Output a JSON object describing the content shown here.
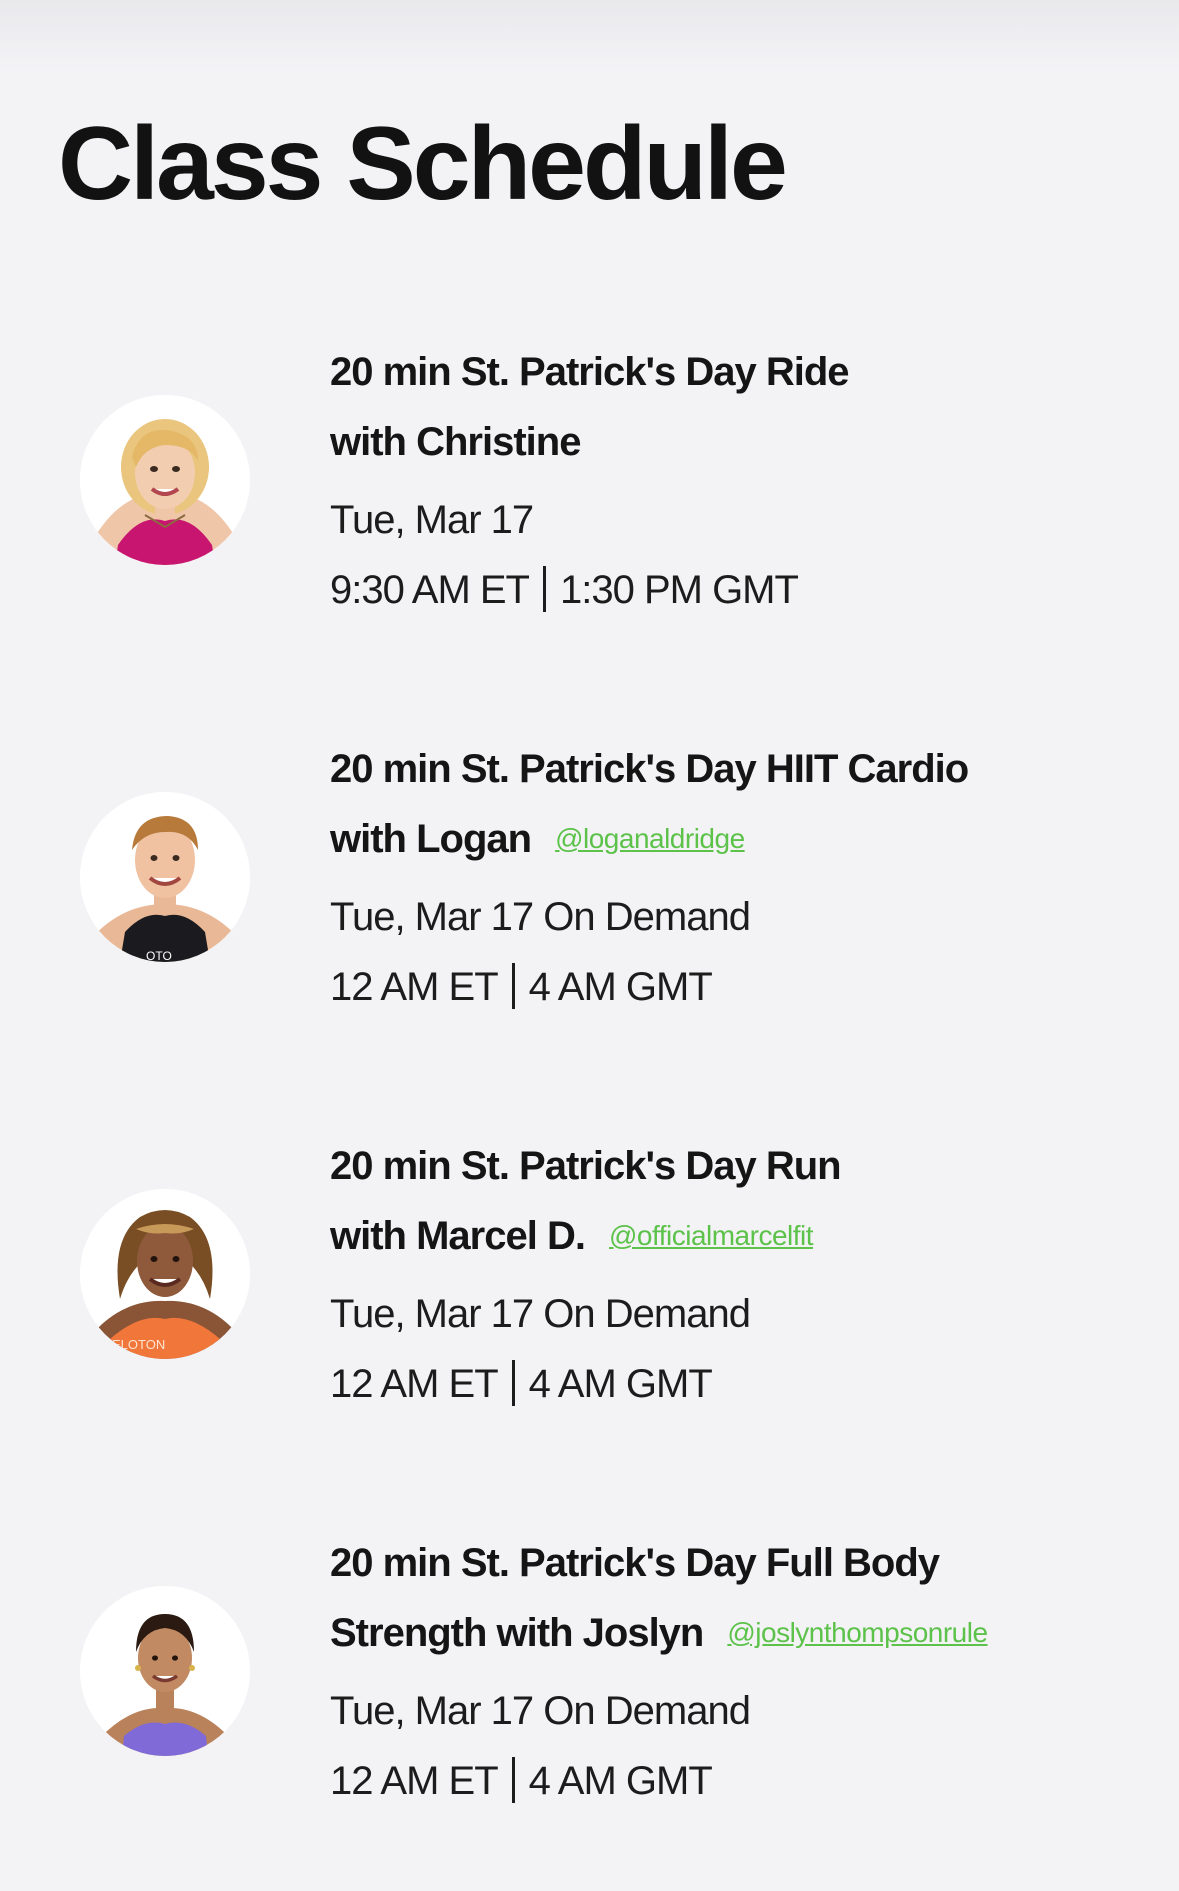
{
  "page": {
    "title": "Class Schedule"
  },
  "classes": [
    {
      "title_line1": "20 min St. Patrick's Day Ride",
      "title_line2": "with Christine",
      "handle": "",
      "date": "Tue, Mar 17",
      "time_et": "9:30 AM ET",
      "time_gmt": "1:30 PM GMT"
    },
    {
      "title_line1": "20 min St. Patrick's Day HIIT Cardio",
      "title_line2": "with Logan",
      "handle": "@loganaldridge",
      "date": "Tue, Mar 17 On Demand",
      "time_et": "12 AM ET",
      "time_gmt": "4 AM GMT"
    },
    {
      "title_line1": "20 min St. Patrick's Day Run",
      "title_line2": "with Marcel D.",
      "handle": "@officialmarcelfit",
      "date": "Tue, Mar 17 On Demand",
      "time_et": "12 AM ET",
      "time_gmt": "4 AM GMT"
    },
    {
      "title_line1": "20 min St. Patrick's Day Full Body",
      "title_line2": "Strength with Joslyn",
      "handle": "@joslynthompsonrule",
      "date": "Tue, Mar 17 On Demand",
      "time_et": "12 AM ET",
      "time_gmt": "4 AM GMT"
    }
  ],
  "colors": {
    "background": "#f3f3f6",
    "text": "#161616",
    "handle": "#5cc24a"
  },
  "brand_text": "ELOTON"
}
